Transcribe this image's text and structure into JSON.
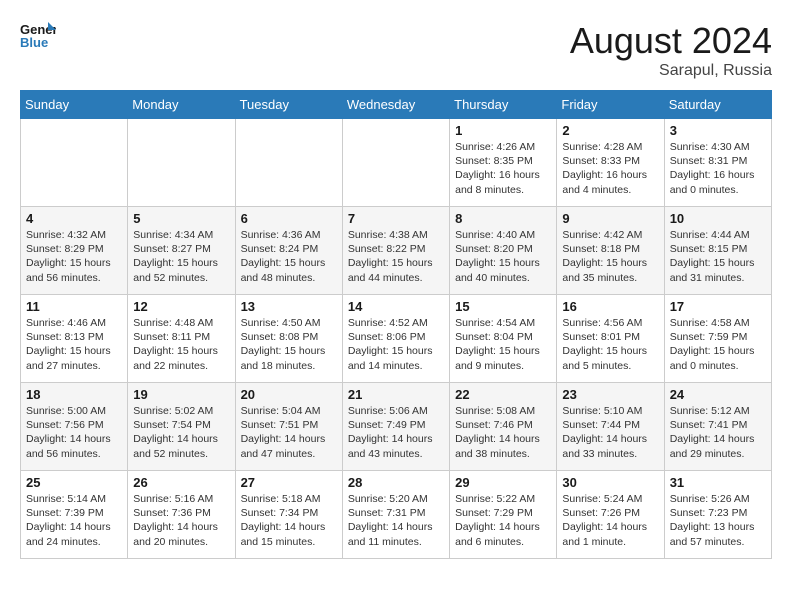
{
  "logo": {
    "line1": "General",
    "line2": "Blue"
  },
  "title": "August 2024",
  "subtitle": "Sarapul, Russia",
  "days_of_week": [
    "Sunday",
    "Monday",
    "Tuesday",
    "Wednesday",
    "Thursday",
    "Friday",
    "Saturday"
  ],
  "weeks": [
    [
      {
        "day": "",
        "info": ""
      },
      {
        "day": "",
        "info": ""
      },
      {
        "day": "",
        "info": ""
      },
      {
        "day": "",
        "info": ""
      },
      {
        "day": "1",
        "info": "Sunrise: 4:26 AM\nSunset: 8:35 PM\nDaylight: 16 hours\nand 8 minutes."
      },
      {
        "day": "2",
        "info": "Sunrise: 4:28 AM\nSunset: 8:33 PM\nDaylight: 16 hours\nand 4 minutes."
      },
      {
        "day": "3",
        "info": "Sunrise: 4:30 AM\nSunset: 8:31 PM\nDaylight: 16 hours\nand 0 minutes."
      }
    ],
    [
      {
        "day": "4",
        "info": "Sunrise: 4:32 AM\nSunset: 8:29 PM\nDaylight: 15 hours\nand 56 minutes."
      },
      {
        "day": "5",
        "info": "Sunrise: 4:34 AM\nSunset: 8:27 PM\nDaylight: 15 hours\nand 52 minutes."
      },
      {
        "day": "6",
        "info": "Sunrise: 4:36 AM\nSunset: 8:24 PM\nDaylight: 15 hours\nand 48 minutes."
      },
      {
        "day": "7",
        "info": "Sunrise: 4:38 AM\nSunset: 8:22 PM\nDaylight: 15 hours\nand 44 minutes."
      },
      {
        "day": "8",
        "info": "Sunrise: 4:40 AM\nSunset: 8:20 PM\nDaylight: 15 hours\nand 40 minutes."
      },
      {
        "day": "9",
        "info": "Sunrise: 4:42 AM\nSunset: 8:18 PM\nDaylight: 15 hours\nand 35 minutes."
      },
      {
        "day": "10",
        "info": "Sunrise: 4:44 AM\nSunset: 8:15 PM\nDaylight: 15 hours\nand 31 minutes."
      }
    ],
    [
      {
        "day": "11",
        "info": "Sunrise: 4:46 AM\nSunset: 8:13 PM\nDaylight: 15 hours\nand 27 minutes."
      },
      {
        "day": "12",
        "info": "Sunrise: 4:48 AM\nSunset: 8:11 PM\nDaylight: 15 hours\nand 22 minutes."
      },
      {
        "day": "13",
        "info": "Sunrise: 4:50 AM\nSunset: 8:08 PM\nDaylight: 15 hours\nand 18 minutes."
      },
      {
        "day": "14",
        "info": "Sunrise: 4:52 AM\nSunset: 8:06 PM\nDaylight: 15 hours\nand 14 minutes."
      },
      {
        "day": "15",
        "info": "Sunrise: 4:54 AM\nSunset: 8:04 PM\nDaylight: 15 hours\nand 9 minutes."
      },
      {
        "day": "16",
        "info": "Sunrise: 4:56 AM\nSunset: 8:01 PM\nDaylight: 15 hours\nand 5 minutes."
      },
      {
        "day": "17",
        "info": "Sunrise: 4:58 AM\nSunset: 7:59 PM\nDaylight: 15 hours\nand 0 minutes."
      }
    ],
    [
      {
        "day": "18",
        "info": "Sunrise: 5:00 AM\nSunset: 7:56 PM\nDaylight: 14 hours\nand 56 minutes."
      },
      {
        "day": "19",
        "info": "Sunrise: 5:02 AM\nSunset: 7:54 PM\nDaylight: 14 hours\nand 52 minutes."
      },
      {
        "day": "20",
        "info": "Sunrise: 5:04 AM\nSunset: 7:51 PM\nDaylight: 14 hours\nand 47 minutes."
      },
      {
        "day": "21",
        "info": "Sunrise: 5:06 AM\nSunset: 7:49 PM\nDaylight: 14 hours\nand 43 minutes."
      },
      {
        "day": "22",
        "info": "Sunrise: 5:08 AM\nSunset: 7:46 PM\nDaylight: 14 hours\nand 38 minutes."
      },
      {
        "day": "23",
        "info": "Sunrise: 5:10 AM\nSunset: 7:44 PM\nDaylight: 14 hours\nand 33 minutes."
      },
      {
        "day": "24",
        "info": "Sunrise: 5:12 AM\nSunset: 7:41 PM\nDaylight: 14 hours\nand 29 minutes."
      }
    ],
    [
      {
        "day": "25",
        "info": "Sunrise: 5:14 AM\nSunset: 7:39 PM\nDaylight: 14 hours\nand 24 minutes."
      },
      {
        "day": "26",
        "info": "Sunrise: 5:16 AM\nSunset: 7:36 PM\nDaylight: 14 hours\nand 20 minutes."
      },
      {
        "day": "27",
        "info": "Sunrise: 5:18 AM\nSunset: 7:34 PM\nDaylight: 14 hours\nand 15 minutes."
      },
      {
        "day": "28",
        "info": "Sunrise: 5:20 AM\nSunset: 7:31 PM\nDaylight: 14 hours\nand 11 minutes."
      },
      {
        "day": "29",
        "info": "Sunrise: 5:22 AM\nSunset: 7:29 PM\nDaylight: 14 hours\nand 6 minutes."
      },
      {
        "day": "30",
        "info": "Sunrise: 5:24 AM\nSunset: 7:26 PM\nDaylight: 14 hours\nand 1 minute."
      },
      {
        "day": "31",
        "info": "Sunrise: 5:26 AM\nSunset: 7:23 PM\nDaylight: 13 hours\nand 57 minutes."
      }
    ]
  ]
}
